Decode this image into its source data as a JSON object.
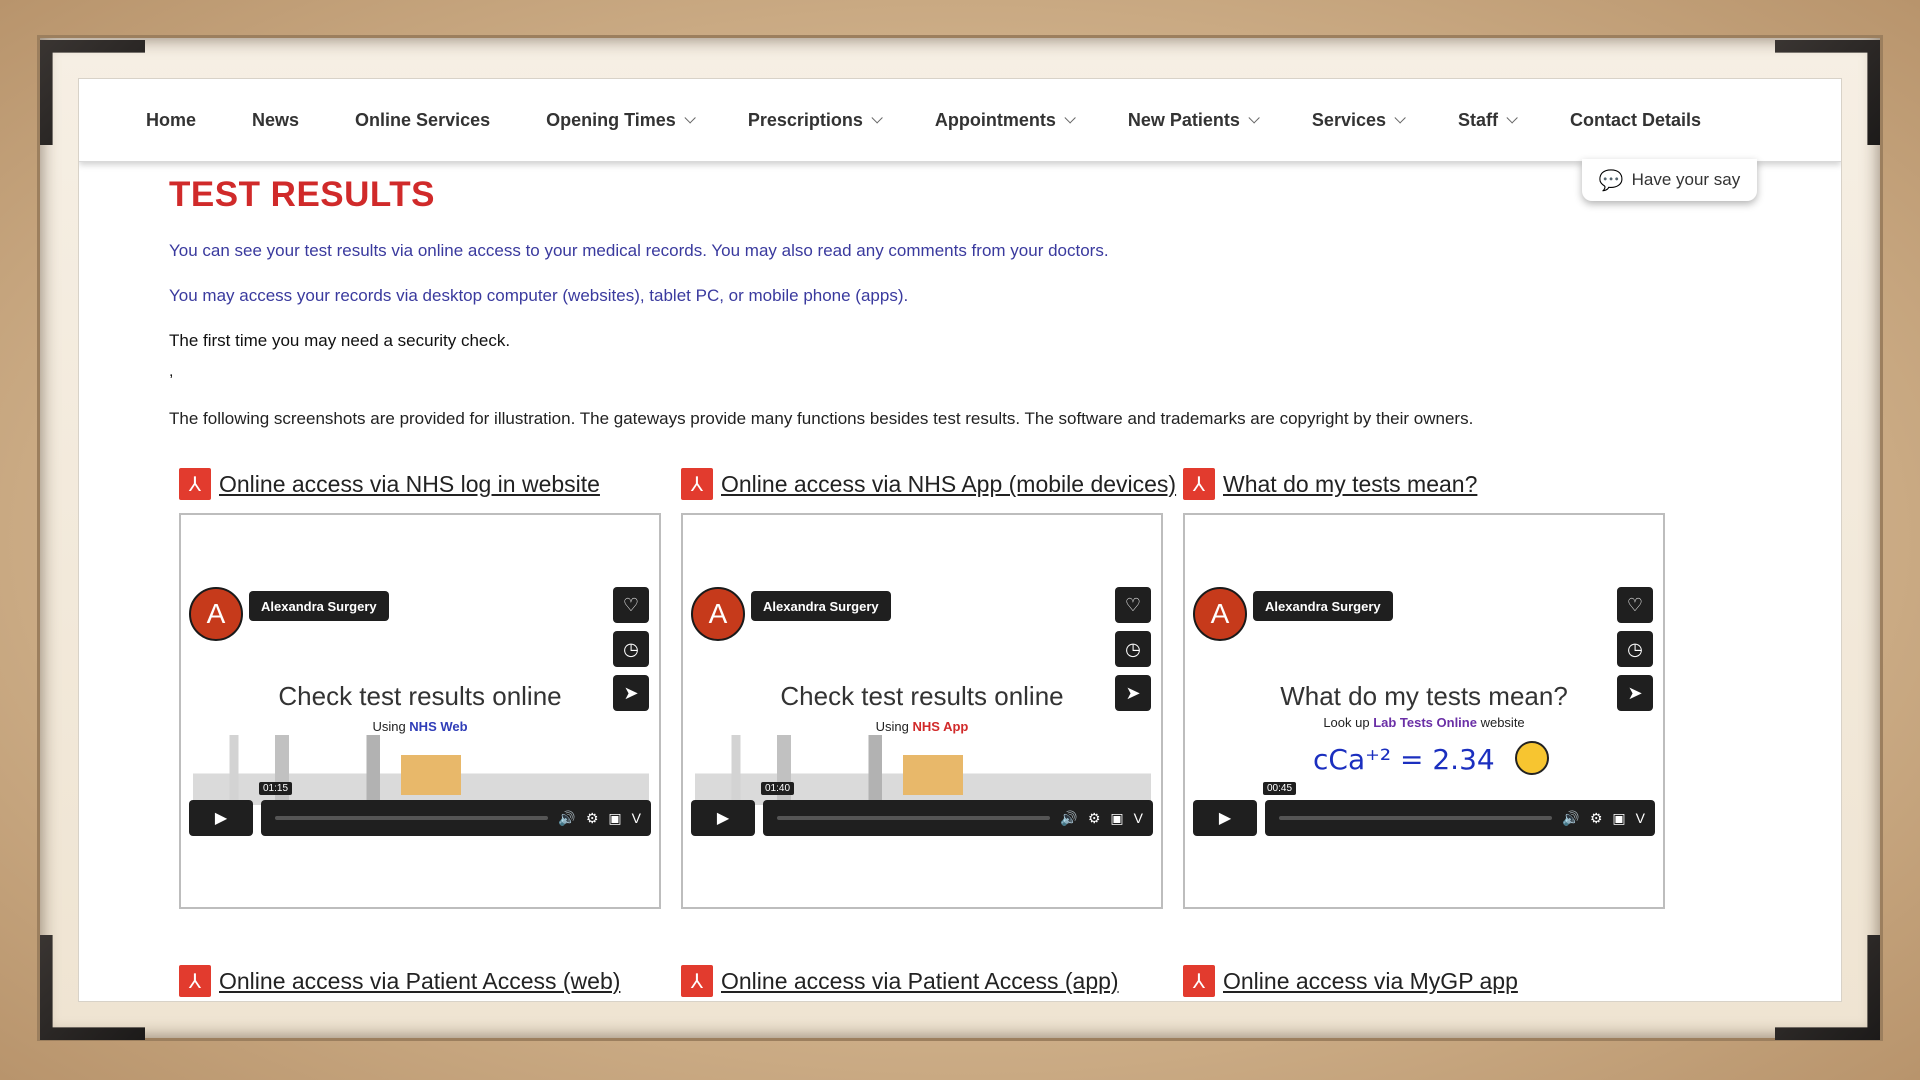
{
  "nav": {
    "items": [
      {
        "label": "Home",
        "dropdown": false
      },
      {
        "label": "News",
        "dropdown": false
      },
      {
        "label": "Online Services",
        "dropdown": false
      },
      {
        "label": "Opening Times",
        "dropdown": true
      },
      {
        "label": "Prescriptions",
        "dropdown": true
      },
      {
        "label": "Appointments",
        "dropdown": true
      },
      {
        "label": "New Patients",
        "dropdown": true
      },
      {
        "label": "Services",
        "dropdown": true
      },
      {
        "label": "Staff",
        "dropdown": true
      },
      {
        "label": "Contact Details",
        "dropdown": false
      }
    ]
  },
  "feedback": {
    "label": "Have your say",
    "icon": "speech-bubbles-icon"
  },
  "page": {
    "title": "TEST RESULTS",
    "p1": "You can see your test results via online access to your medical records. You may also read any comments from your doctors.",
    "p2": "You may access your records via desktop computer (websites), tablet PC, or mobile phone (apps).",
    "p3": "The first time you may need a security check.",
    "dot": ",",
    "p4": "The following screenshots are provided for illustration. The gateways provide many functions besides test results. The software and trademarks are copyright by their owners."
  },
  "cards": [
    {
      "link": "Online access via NHS log in website",
      "video": {
        "avatar": "A",
        "channel": "Alexandra Surgery",
        "title": "Check test results online",
        "sub_prefix": "Using ",
        "sub_highlight": "NHS Web",
        "sub_suffix": "",
        "time": "01:15"
      }
    },
    {
      "link": "Online access via NHS App (mobile devices)",
      "video": {
        "avatar": "A",
        "channel": "Alexandra Surgery",
        "title": "Check test results online",
        "sub_prefix": "Using ",
        "sub_highlight": "NHS App",
        "sub_suffix": "",
        "time": "01:40"
      }
    },
    {
      "link": "What do my tests mean?",
      "video": {
        "avatar": "A",
        "channel": "Alexandra Surgery",
        "title": "What do my tests mean?",
        "sub_prefix": "Look up ",
        "sub_highlight": "Lab Tests Online",
        "sub_suffix": " website",
        "formula": "cCa⁺² = 2.34",
        "time": "00:45"
      }
    }
  ],
  "cards2": [
    {
      "link": "Online access via Patient Access (web)"
    },
    {
      "link": "Online access via Patient Access (app)"
    },
    {
      "link": "Online access via MyGP app"
    }
  ]
}
